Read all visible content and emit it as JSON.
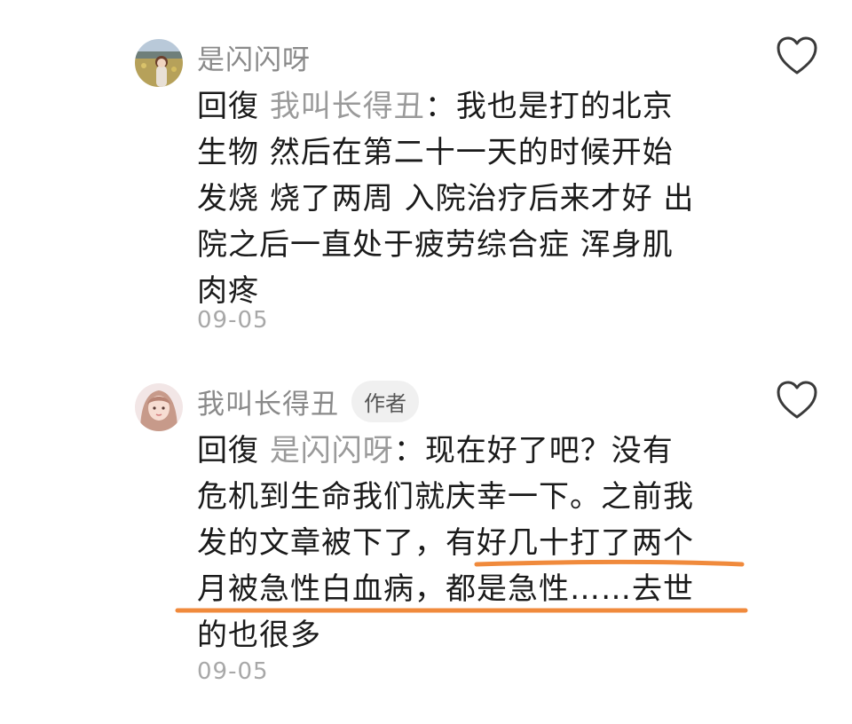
{
  "comments": [
    {
      "username": "是闪闪呀",
      "reply_prefix": "回復",
      "reply_target": "我叫长得丑",
      "reply_colon": "：",
      "lines": [
        "我也是打的北京",
        "生物 然后在第二十一天的时候开始",
        "发烧 烧了两周 入院治疗后来才好 出",
        "院之后一直处于疲劳综合症 浑身肌",
        "肉疼"
      ],
      "date": "09-05",
      "avatar_icon": "landscape-portrait-avatar",
      "like_icon": "heart-outline-icon"
    },
    {
      "username": "我叫长得丑",
      "badge": "作者",
      "reply_prefix": "回復",
      "reply_target": "是闪闪呀",
      "reply_colon": "：",
      "lines": [
        "现在好了吧？没有",
        "危机到生命我们就庆幸一下。之前我",
        "发的文章被下了，有好几十打了两个",
        "月被急性白血病，都是急性……去世",
        "的也很多"
      ],
      "date": "09-05",
      "avatar_icon": "girl-portrait-avatar",
      "like_icon": "heart-outline-icon"
    }
  ],
  "colors": {
    "text": "#1a1a1a",
    "muted": "#8a8a8a",
    "date": "#a8a8a8",
    "underline": "#f08a3c",
    "badge_bg": "#f0f0f0"
  }
}
